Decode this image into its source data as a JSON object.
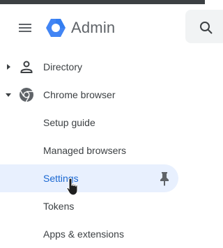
{
  "header": {
    "app_name": "Admin"
  },
  "icons": {
    "menu": "hamburger-menu-icon",
    "logo": "hexagon-logo-icon",
    "search": "search-icon",
    "directory": "person-icon",
    "chrome": "chrome-icon",
    "pin": "pin-icon",
    "cursor": "hand-cursor-icon"
  },
  "colors": {
    "selected_bg": "#e8f0fe",
    "selected_text": "#1967d2",
    "logo_blue": "#4285f4",
    "text": "#3c4043"
  },
  "sidebar": {
    "items": [
      {
        "label": "Directory",
        "expanded": false
      },
      {
        "label": "Chrome browser",
        "expanded": true
      },
      {
        "label": "Setup guide"
      },
      {
        "label": "Managed browsers"
      },
      {
        "label": "Settings",
        "selected": true
      },
      {
        "label": "Tokens"
      },
      {
        "label": "Apps & extensions"
      }
    ]
  }
}
